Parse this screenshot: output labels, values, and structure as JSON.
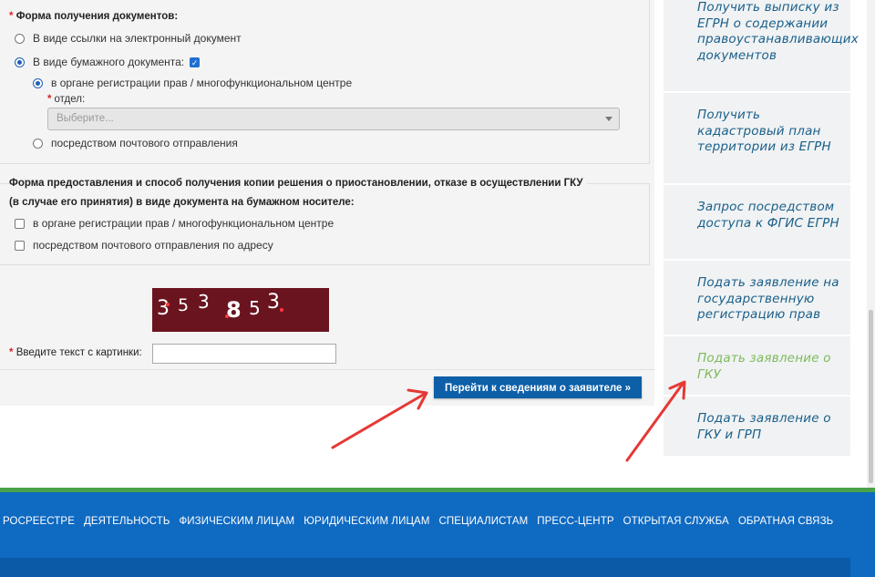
{
  "form": {
    "receive_docs": {
      "legend": "Форма получения документов:",
      "required_mark": "*",
      "option_link": "В виде ссылки на электронный документ",
      "option_paper": "В виде бумажного документа:",
      "sub_option_office": "в органе регистрации прав / многофункциональном центре",
      "department_label": "отдел:",
      "department_placeholder": "Выберите...",
      "sub_option_post": "посредством почтового отправления"
    },
    "copy_decision": {
      "legend_line1": "Форма предоставления и способ получения копии решения о приостановлении, отказе в осуществлении ГКУ",
      "legend_line2": "(в случае его принятия) в виде документа на бумажном носителе:",
      "option_office": "в органе регистрации прав / многофункциональном центре",
      "option_post": "посредством почтового отправления по адресу"
    },
    "captcha": {
      "digits": [
        "3",
        "5",
        "3",
        "8",
        "5",
        "3"
      ],
      "label": "Введите текст с картинки:",
      "required_mark": "*",
      "input_value": ""
    },
    "next_button": "Перейти к сведениям о заявителе »"
  },
  "sidebar": {
    "items": [
      {
        "label": "Получить выписку из ЕГРН о содержании правоустанавливающих документов",
        "active": false
      },
      {
        "label": "Получить кадастровый план территории из ЕГРН",
        "active": false
      },
      {
        "label": "Запрос посредством доступа к ФГИС ЕГРН",
        "active": false
      },
      {
        "label": "Подать заявление на государственную регистрацию прав",
        "active": false
      },
      {
        "label": "Подать заявление о ГКУ",
        "active": true
      },
      {
        "label": "Подать заявление о ГКУ и ГРП",
        "active": false
      }
    ]
  },
  "footer": {
    "nav": [
      "РОСРЕЕСТРЕ",
      "ДЕЯТЕЛЬНОСТЬ",
      "ФИЗИЧЕСКИМ ЛИЦАМ",
      "ЮРИДИЧЕСКИМ ЛИЦАМ",
      "СПЕЦИАЛИСТАМ",
      "ПРЕСС-ЦЕНТР",
      "ОТКРЫТАЯ СЛУЖБА",
      "ОБРАТНАЯ СВЯЗЬ"
    ]
  },
  "colors": {
    "button": "#0d5fa8",
    "sidebar_link": "#1a5f8a",
    "sidebar_active": "#7dbb5c",
    "footer": "#0f6ac2",
    "annotation_arrow": "#e53935"
  }
}
